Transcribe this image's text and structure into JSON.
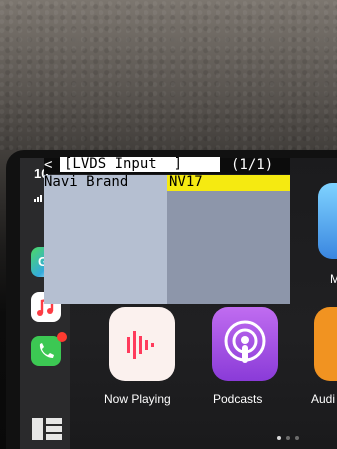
{
  "status_bar": {
    "time": "10"
  },
  "osd": {
    "back_symbol": "<",
    "title": "[LVDS Input  ]",
    "page_indicator": "(1/1)",
    "rows": [
      {
        "label": "Navi Brand",
        "value": "NV17"
      }
    ],
    "colors": {
      "highlight": "#f5ea11",
      "left_column": "#b5bfd1",
      "right_column": "#8d96aa"
    }
  },
  "home": {
    "apps": [
      {
        "label": "Now Playing",
        "icon": "now-playing-icon"
      },
      {
        "label": "Podcasts",
        "icon": "podcasts-icon"
      },
      {
        "label": "Audi",
        "icon": "audible-icon"
      }
    ],
    "partial_label_right": "M",
    "page_dots": {
      "count": 3,
      "active": 0
    }
  },
  "dock": {
    "icons": [
      "maps-icon",
      "music-icon",
      "phone-icon",
      "dashboard-grid-icon"
    ]
  }
}
